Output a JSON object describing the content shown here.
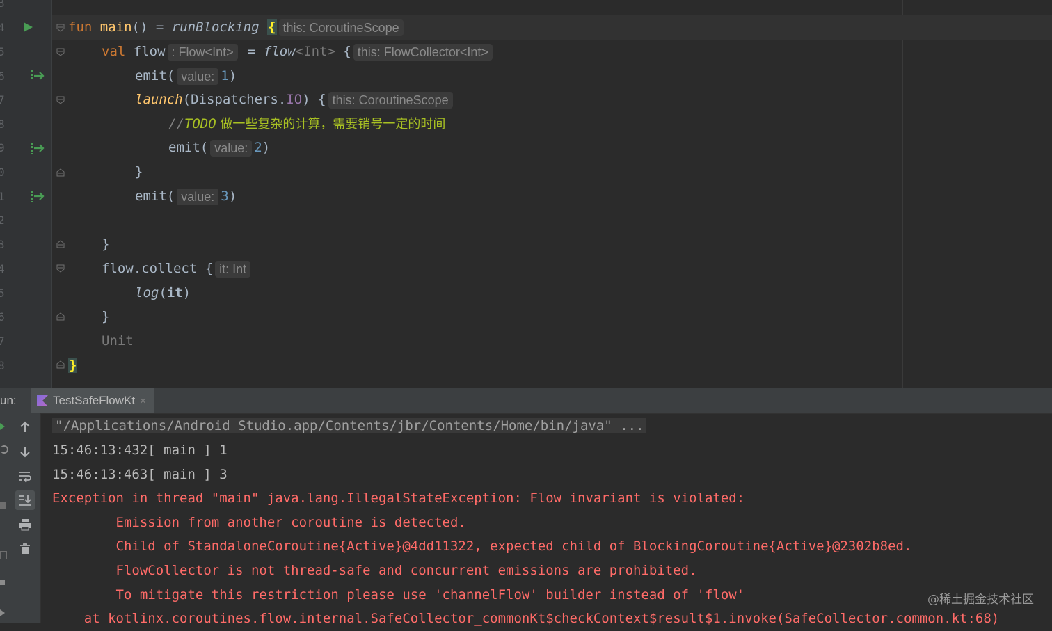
{
  "editor": {
    "line_numbers": [
      "3",
      "4",
      "5",
      "6",
      "7",
      "8",
      "9",
      "0",
      "1",
      "2",
      "3",
      "4",
      "5",
      "6",
      "7",
      "8"
    ],
    "hints": {
      "main_scope": "this: CoroutineScope",
      "flow_type": ": Flow<Int>",
      "flow_collector": "this: FlowCollector<Int>",
      "value": "value:",
      "launch_scope": "this: CoroutineScope",
      "it_type": "it: Int"
    },
    "code": {
      "fun_kw": "fun",
      "main_name": "main",
      "main_sig": "() = ",
      "run_blocking": "runBlocking",
      "val_kw": "val",
      "flow_var": "flow",
      "eq": " = ",
      "flow_builder": "flow",
      "flow_generic": "<Int>",
      "open_brace": " {",
      "emit_call": "emit(",
      "emit_v1": "1",
      "emit_v2": "2",
      "emit_v3": "3",
      "close_paren": ")",
      "launch_fn": "launch",
      "launch_open": "(Dispatchers.",
      "io": "IO",
      "launch_close": ") {",
      "comment_prefix": "//",
      "todo_kw": "TODO",
      "todo_text": " 做一些复杂的计算，需要销号一定的时间",
      "close_brace": "}",
      "flow_collect": "flow.collect {",
      "log_fn": "log",
      "log_args": "(",
      "it_kw": "it",
      "unit": "Unit"
    }
  },
  "run_panel": {
    "label": "un:",
    "tab_title": "TestSafeFlowKt",
    "tab_close": "×",
    "tools": [
      "up-arrow-icon",
      "down-arrow-icon",
      "soft-wrap-icon",
      "scroll-to-end-icon",
      "print-icon",
      "trash-icon"
    ]
  },
  "console": {
    "command": "\"/Applications/Android Studio.app/Contents/jbr/Contents/Home/bin/java\" ...",
    "out1": "15:46:13:432[ main ] 1",
    "out2": "15:46:13:463[ main ] 3",
    "err1": "Exception in thread \"main\" java.lang.IllegalStateException: Flow invariant is violated:",
    "err2": "        Emission from another coroutine is detected.",
    "err3": "        Child of StandaloneCoroutine{Active}@4dd11322, expected child of BlockingCoroutine{Active}@2302b8ed.",
    "err4": "        FlowCollector is not thread-safe and concurrent emissions are prohibited.",
    "err5": "        To mitigate this restriction please use 'channelFlow' builder instead of 'flow'",
    "err6": "    at kotlinx.coroutines.flow.internal.SafeCollector_commonKt$checkContext$result$1.invoke(SafeCollector.common.kt:68)"
  },
  "watermark": "@稀土掘金技术社区",
  "colors": {
    "background": "#2b2b2b",
    "keyword": "#cc7832",
    "function": "#ffc66d",
    "number": "#6897bb",
    "error": "#ff6b68",
    "todo": "#a8c023"
  }
}
